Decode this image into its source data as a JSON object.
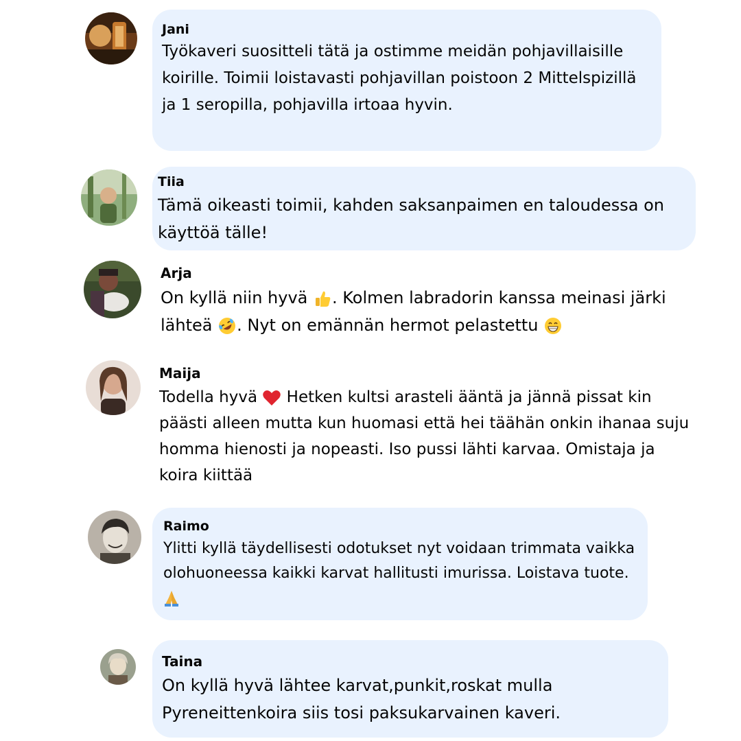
{
  "comments": [
    {
      "author": "Jani",
      "text": "Työkaveri suositteli tätä ja ostimme meidän pohjavillaisille koirille. Toimii loistavasti pohjavillan poistoon 2 Mittelspizillä ja 1 seropilla, pohjavilla irtoaa hyvin."
    },
    {
      "author": "Tiia",
      "text": "Tämä oikeasti toimii, kahden saksanpaimen en taloudessa on käyttöä tälle!"
    },
    {
      "author": "Arja",
      "text_1": "On kyllä niin hyvä",
      "emoji_1": "thumbs-up",
      "text_2": ". Kolmen labradorin kanssa meinasi järki lähteä",
      "emoji_2": "rolling-on-floor-laughing",
      "text_3": ". Nyt on emännän hermot pelastettu",
      "emoji_3": "grinning-face"
    },
    {
      "author": "Maija",
      "text_1": "Todella hyvä",
      "emoji_1": "red-heart",
      "text_2": "Hetken kultsi arasteli ääntä ja jännä pissat kin päästi alleen mutta kun huomasi että hei täähän onkin ihanaa suju homma hienosti ja nopeasti. Iso pussi lähti karvaa. Omistaja ja koira kiittää"
    },
    {
      "author": "Raimo",
      "text": "Ylitti kyllä täydellisesti odotukset nyt voidaan trimmata vaikka olohuoneessa kaikki karvat hallitusti imurissa. Loistava tuote.",
      "emoji": "folded-hands"
    },
    {
      "author": "Taina",
      "text": "On kyllä hyvä lähtee karvat,punkit,roskat mulla Pyreneittenkoira siis tosi paksukarvainen kaveri."
    }
  ],
  "colors": {
    "bubble": "#e9f2fe",
    "text": "#050505"
  }
}
